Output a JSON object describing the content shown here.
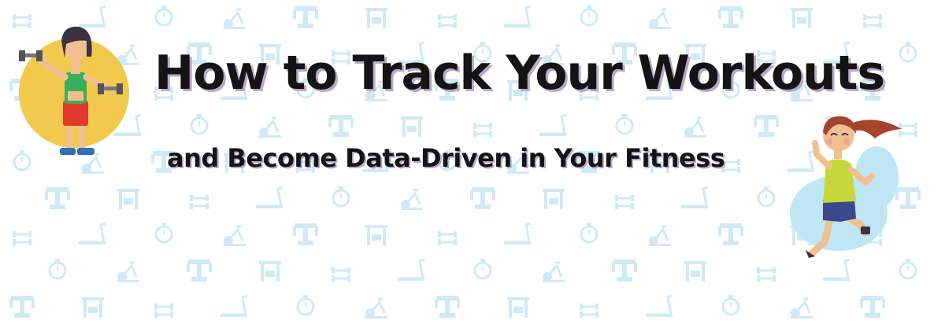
{
  "banner": {
    "title": "How to Track Your Workouts",
    "subtitle": "and Become Data-Driven in Your Fitness"
  },
  "background": {
    "pattern_icons": [
      "dumbbell-icon",
      "treadmill-icon",
      "stopwatch-icon",
      "exercise-bike-icon",
      "weight-machine-icon",
      "chest-press-icon"
    ],
    "pattern_color": "#cfeaf5"
  },
  "illustrations": {
    "left": "man-lifting-dumbbells-illustration",
    "right": "woman-running-illustration"
  },
  "colors": {
    "title_text": "#141414",
    "title_shadow": "#b9a9c8",
    "circle_yellow": "#f2c94c",
    "runner_splash": "#bfe6f4"
  }
}
